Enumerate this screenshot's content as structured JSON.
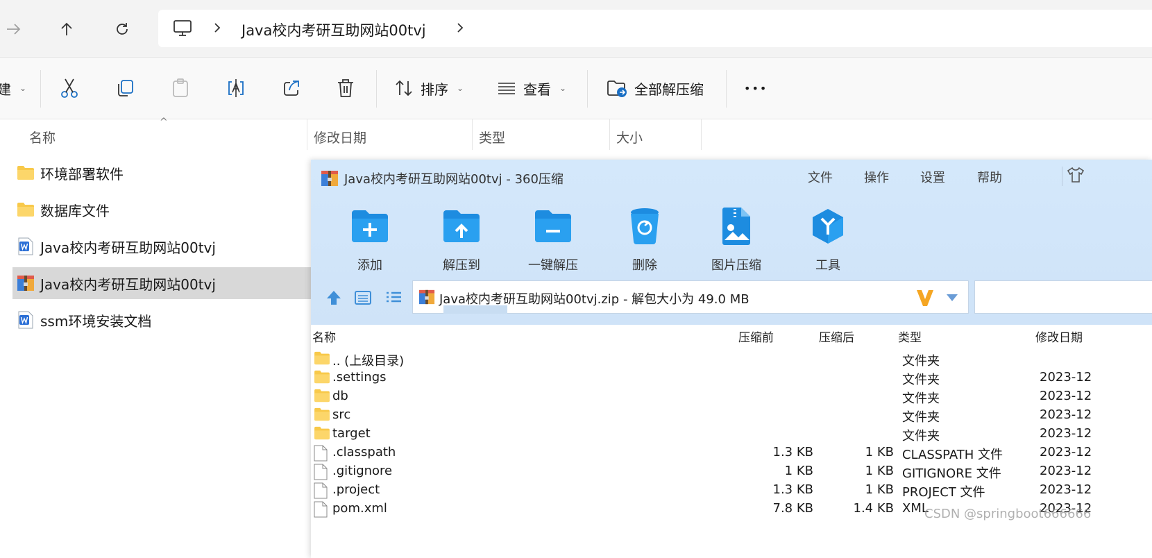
{
  "address_bar": {
    "breadcrumb": "Java校内考研互助网站00tvj"
  },
  "command_bar": {
    "new_label_partial": "建",
    "sort_label": "排序",
    "view_label": "查看",
    "extract_all_label": "全部解压缩",
    "more_label": "•••"
  },
  "columns": {
    "name": "名称",
    "modified": "修改日期",
    "type": "类型",
    "size": "大小"
  },
  "explorer_items": [
    {
      "name": "环境部署软件",
      "icon": "folder-icon"
    },
    {
      "name": "数据库文件",
      "icon": "folder-icon"
    },
    {
      "name": "Java校内考研互助网站00tvj",
      "icon": "word-doc-icon"
    },
    {
      "name": "Java校内考研互助网站00tvj",
      "icon": "zip-archive-icon",
      "selected": true
    },
    {
      "name": "ssm环境安装文档",
      "icon": "word-doc-icon"
    }
  ],
  "zip_window": {
    "title": "Java校内考研互助网站00tvj - 360压缩",
    "menu": [
      "文件",
      "操作",
      "设置",
      "帮助"
    ],
    "toolbar": [
      "添加",
      "解压到",
      "一键解压",
      "删除",
      "图片压缩",
      "工具"
    ],
    "path_text": "Java校内考研互助网站00tvj.zip - 解包大小为 49.0 MB",
    "columns": {
      "name": "名称",
      "before": "压缩前",
      "after": "压缩后",
      "type": "类型",
      "modified": "修改日期"
    },
    "rows": [
      {
        "name": ".. (上级目录)",
        "before": "",
        "after": "",
        "type": "文件夹",
        "date": "",
        "icon": "folder-icon"
      },
      {
        "name": ".settings",
        "before": "",
        "after": "",
        "type": "文件夹",
        "date": "2023-12",
        "icon": "folder-icon"
      },
      {
        "name": "db",
        "before": "",
        "after": "",
        "type": "文件夹",
        "date": "2023-12",
        "icon": "folder-icon"
      },
      {
        "name": "src",
        "before": "",
        "after": "",
        "type": "文件夹",
        "date": "2023-12",
        "icon": "folder-icon"
      },
      {
        "name": "target",
        "before": "",
        "after": "",
        "type": "文件夹",
        "date": "2023-12",
        "icon": "folder-icon"
      },
      {
        "name": ".classpath",
        "before": "1.3 KB",
        "after": "1 KB",
        "type": "CLASSPATH 文件",
        "date": "2023-12",
        "icon": "file-icon"
      },
      {
        "name": ".gitignore",
        "before": "1 KB",
        "after": "1 KB",
        "type": "GITIGNORE 文件",
        "date": "2023-12",
        "icon": "file-icon"
      },
      {
        "name": ".project",
        "before": "1.3 KB",
        "after": "1 KB",
        "type": "PROJECT 文件",
        "date": "2023-12",
        "icon": "file-icon"
      },
      {
        "name": "pom.xml",
        "before": "7.8 KB",
        "after": "1.4 KB",
        "type": "XML",
        "date": "2023-12",
        "icon": "file-icon"
      }
    ]
  },
  "watermark": "CSDN @springboot666666"
}
